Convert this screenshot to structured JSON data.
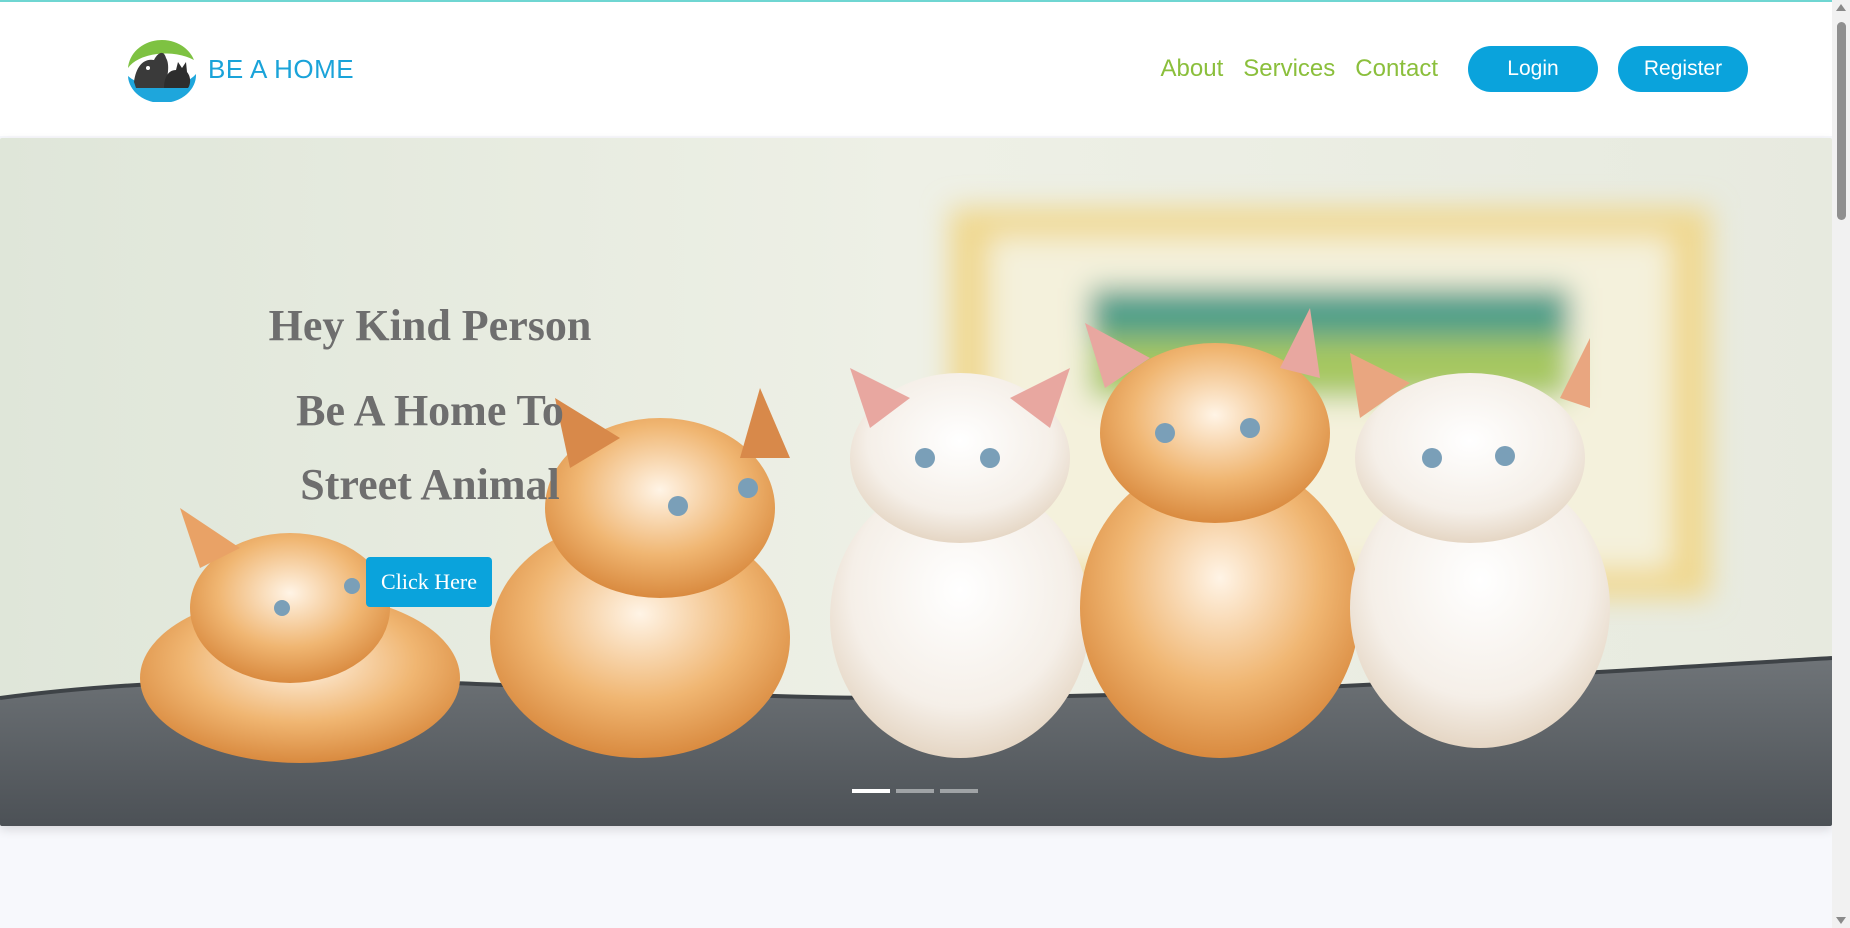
{
  "header": {
    "brand": "BE A HOME",
    "nav": [
      {
        "label": "About"
      },
      {
        "label": "Services"
      },
      {
        "label": "Contact"
      }
    ],
    "login_label": "Login",
    "register_label": "Register"
  },
  "hero": {
    "title": "Hey Kind Person",
    "subtitle_line1": "Be A Home To",
    "subtitle_line2": "Street Animal",
    "cta_label": "Click Here",
    "carousel": {
      "slides": 3,
      "active": 0
    }
  },
  "colors": {
    "brand_blue": "#0aa3dc",
    "nav_green": "#8bbf3c",
    "hero_text": "#6e6e6e"
  },
  "icons": [
    "logo-icon",
    "scroll-up-icon",
    "scroll-down-icon"
  ]
}
